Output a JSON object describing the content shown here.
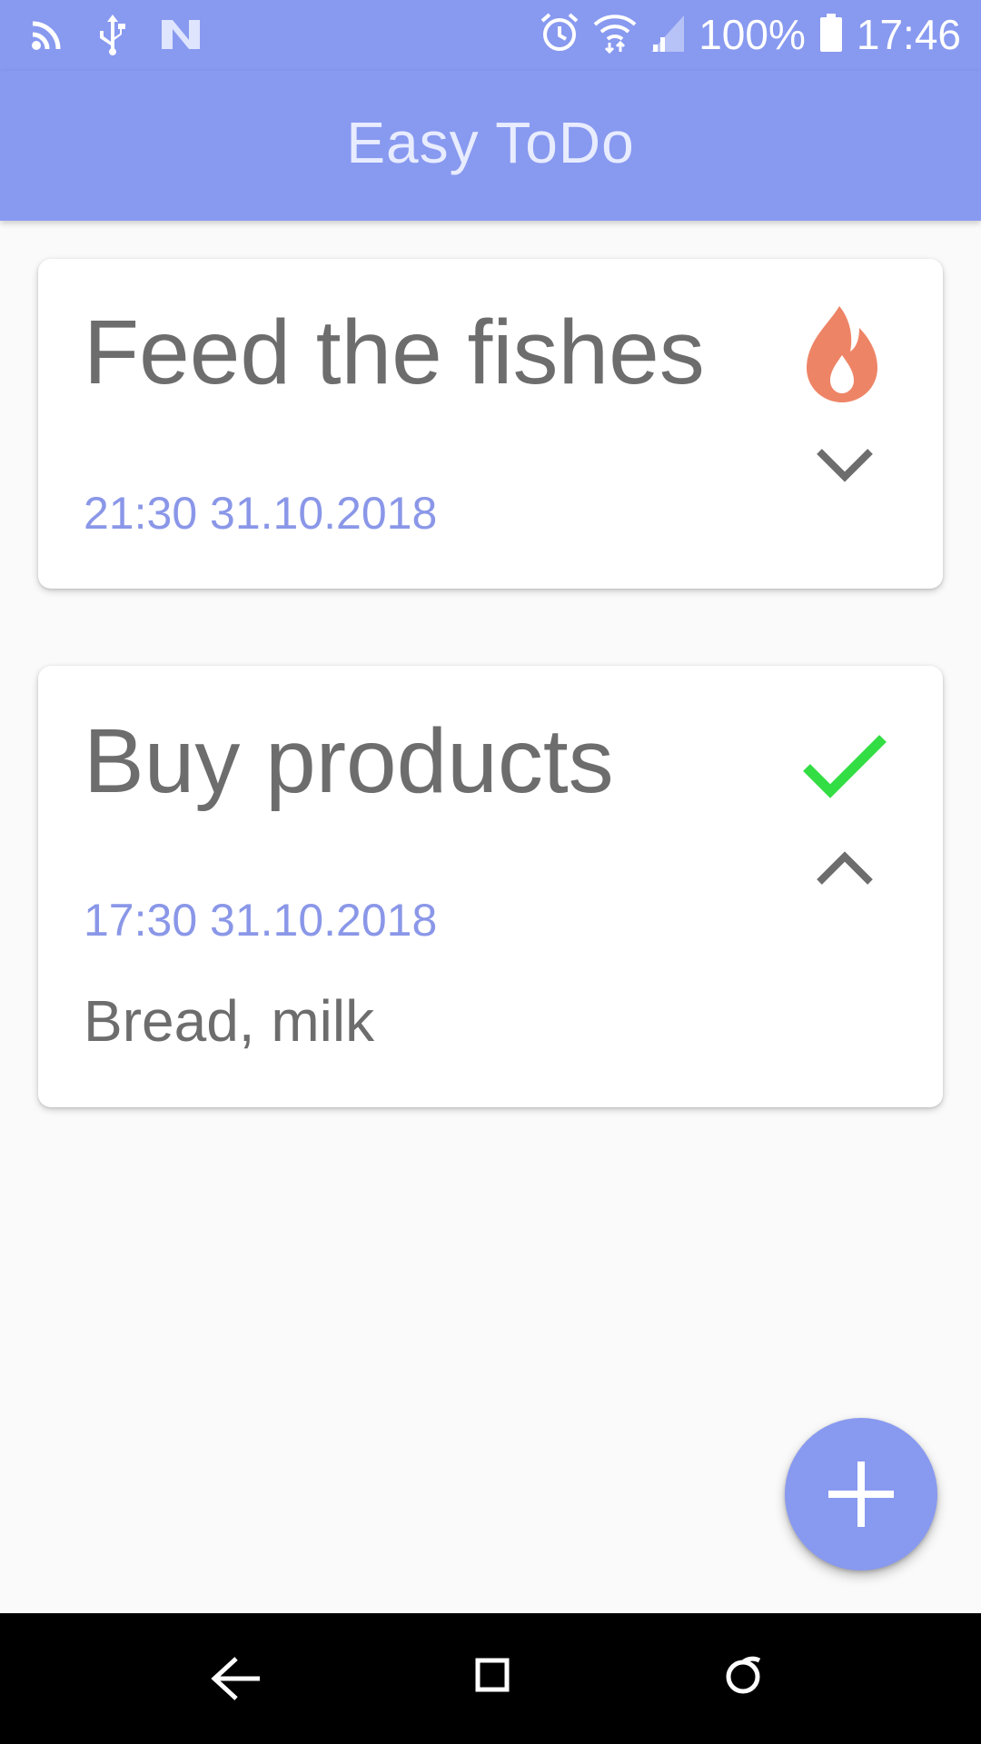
{
  "status_bar": {
    "icons_left": [
      "cast-icon",
      "usb-icon",
      "n-logo-icon"
    ],
    "icons_right": [
      "alarm-icon",
      "wifi-icon",
      "signal-icon",
      "battery-icon"
    ],
    "battery": "100%",
    "time": "17:46"
  },
  "app_bar": {
    "title": "Easy ToDo"
  },
  "tasks": [
    {
      "title": "Feed the fishes",
      "datetime": "21:30 31.10.2018",
      "status_icon": "flame-icon",
      "toggle_icon": "chevron-down-icon",
      "note": ""
    },
    {
      "title": "Buy products",
      "datetime": "17:30 31.10.2018",
      "status_icon": "check-icon",
      "toggle_icon": "chevron-up-icon",
      "note": "Bread, milk"
    }
  ],
  "fab": {
    "icon": "plus-icon"
  },
  "nav_bar": {
    "icons": [
      "back-icon",
      "home-icon",
      "recents-icon"
    ]
  },
  "colors": {
    "primary": "#8899f0",
    "date_text": "#8a97e8",
    "flame": "#ee8466",
    "check": "#33dd44",
    "text": "#6d6d6d"
  }
}
